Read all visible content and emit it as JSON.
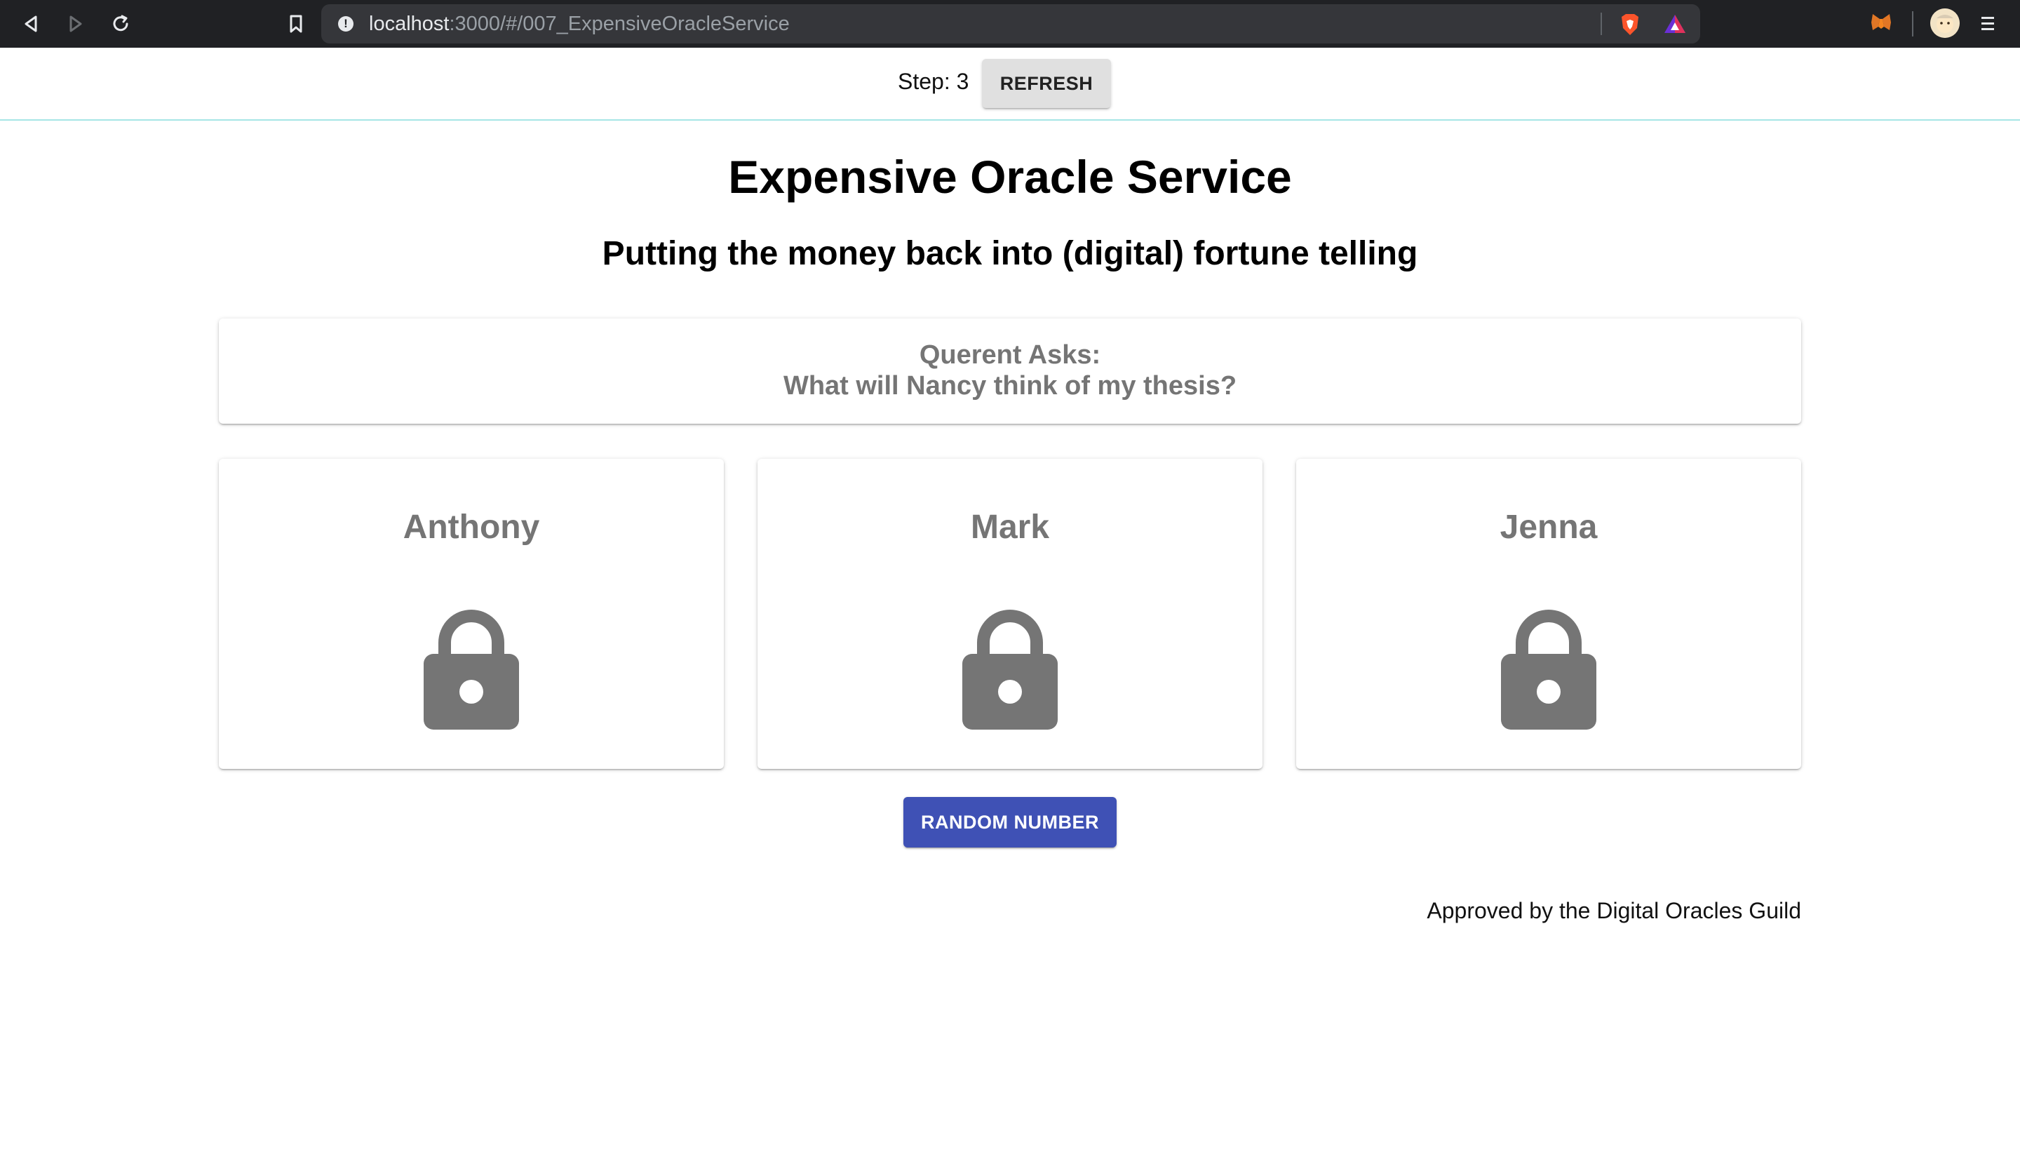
{
  "browser": {
    "url_host": "localhost",
    "url_rest": ":3000/#/007_ExpensiveOracleService"
  },
  "app": {
    "step_label": "Step:",
    "step_value": "3",
    "refresh_label": "REFRESH",
    "title": "Expensive Oracle Service",
    "subtitle": "Putting the money back into (digital) fortune telling",
    "question": {
      "heading": "Querent Asks:",
      "text": "What will Nancy think of my thesis?"
    },
    "oracles": [
      {
        "name": "Anthony",
        "icon": "lock-icon"
      },
      {
        "name": "Mark",
        "icon": "lock-icon"
      },
      {
        "name": "Jenna",
        "icon": "lock-icon"
      }
    ],
    "random_button_label": "RANDOM NUMBER",
    "footer": "Approved by the Digital Oracles Guild"
  },
  "colors": {
    "primary": "#3f51b5",
    "muted_text": "#757575",
    "divider": "#a6e6e6",
    "chrome_bg": "#202124"
  }
}
